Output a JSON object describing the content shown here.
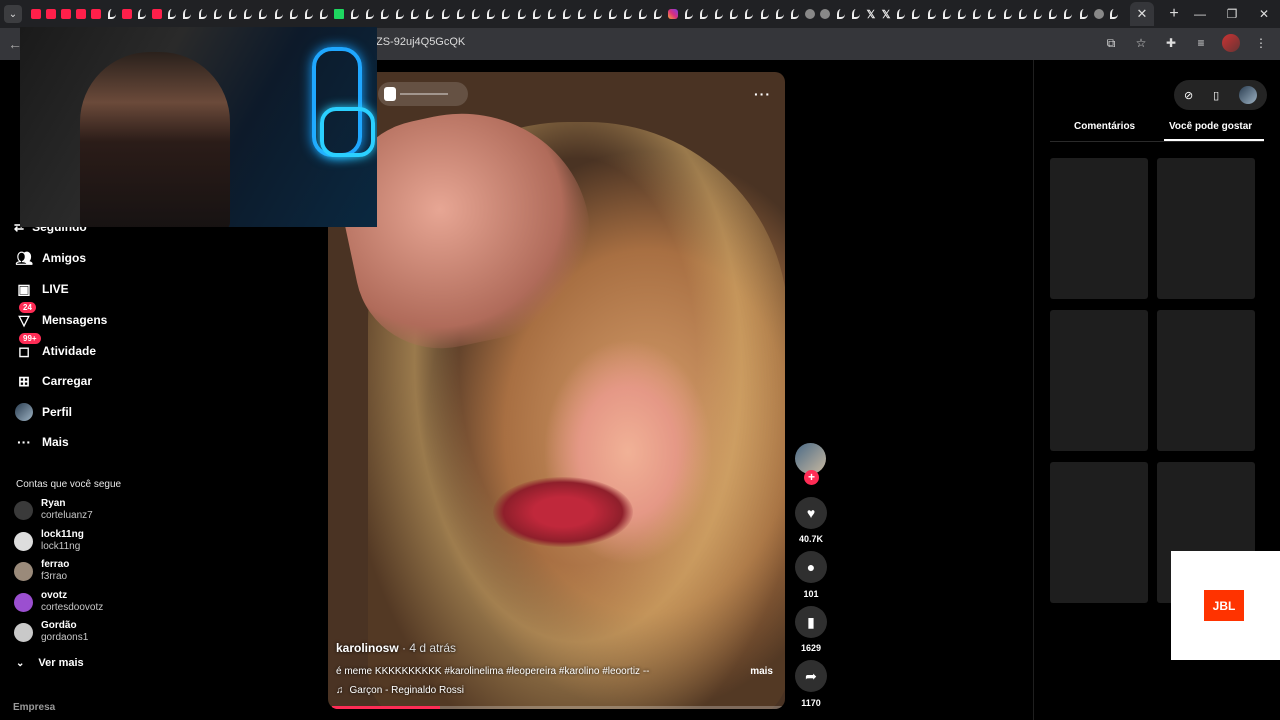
{
  "browser": {
    "url": "ZS-92uj4Q5GcQK",
    "tab_menu_icon": "chevron-down-icon",
    "new_tab_label": "+",
    "tabs_favicons": [
      "yt",
      "yt",
      "yt",
      "yt",
      "yt",
      "tt",
      "yt",
      "tt",
      "yt",
      "tt",
      "tt",
      "tt",
      "tt",
      "tt",
      "tt",
      "tt",
      "tt",
      "tt",
      "tt",
      "tt",
      "kk",
      "tt",
      "tt",
      "tt",
      "tt",
      "tt",
      "tt",
      "tt",
      "tt",
      "tt",
      "tt",
      "tt",
      "tt",
      "tt",
      "tt",
      "tt",
      "tt",
      "tt",
      "tt",
      "tt",
      "tt",
      "tt",
      "ig",
      "tt",
      "tt",
      "tt",
      "tt",
      "tt",
      "tt",
      "tt",
      "tt",
      "gl",
      "gl",
      "tt",
      "tt",
      "xx",
      "xx",
      "tt",
      "tt",
      "tt",
      "tt",
      "tt",
      "tt",
      "tt",
      "tt",
      "tt",
      "tt",
      "tt",
      "tt",
      "tt",
      "gl",
      "tt"
    ]
  },
  "sidebar": {
    "items": [
      {
        "label": "Seguindo",
        "icon": "following-icon"
      },
      {
        "label": "Amigos",
        "icon": "friends-icon"
      },
      {
        "label": "LIVE",
        "icon": "live-icon"
      },
      {
        "label": "Mensagens",
        "icon": "messages-icon",
        "badge": "24"
      },
      {
        "label": "Atividade",
        "icon": "activity-icon",
        "badge": "99+"
      },
      {
        "label": "Carregar",
        "icon": "upload-icon"
      },
      {
        "label": "Perfil",
        "icon": "profile-avatar"
      },
      {
        "label": "Mais",
        "icon": "more-icon"
      }
    ],
    "following_title": "Contas que você segue",
    "accounts": [
      {
        "name": "Ryan",
        "handle": "corteluanz7"
      },
      {
        "name": "lock11ng",
        "handle": "lock11ng"
      },
      {
        "name": "ferrao",
        "handle": "f3rrao"
      },
      {
        "name": "ovotz",
        "handle": "cortesdoovotz"
      },
      {
        "name": "Gordão",
        "handle": "gordaons1"
      }
    ],
    "see_more": "Ver mais",
    "footer": "Empresa"
  },
  "video": {
    "author": "karolinosw",
    "date": " · 4 d atrás",
    "description": "é meme KKKKKKKKKK #karolinelima #leopereira #karolino #leoortiz --",
    "more": "mais",
    "music": "Garçon - Reginaldo Rossi",
    "progress": 0.24
  },
  "actions": {
    "likes": "40.7K",
    "comments": "101",
    "saves": "1629",
    "shares": "1170"
  },
  "right_panel": {
    "tab_comments": "Comentários",
    "tab_suggested": "Você pode gostar"
  },
  "ad": {
    "brand": "JBL"
  },
  "colors": {
    "accent": "#fe2c55",
    "background": "#000000",
    "tabbar": "#202124"
  }
}
